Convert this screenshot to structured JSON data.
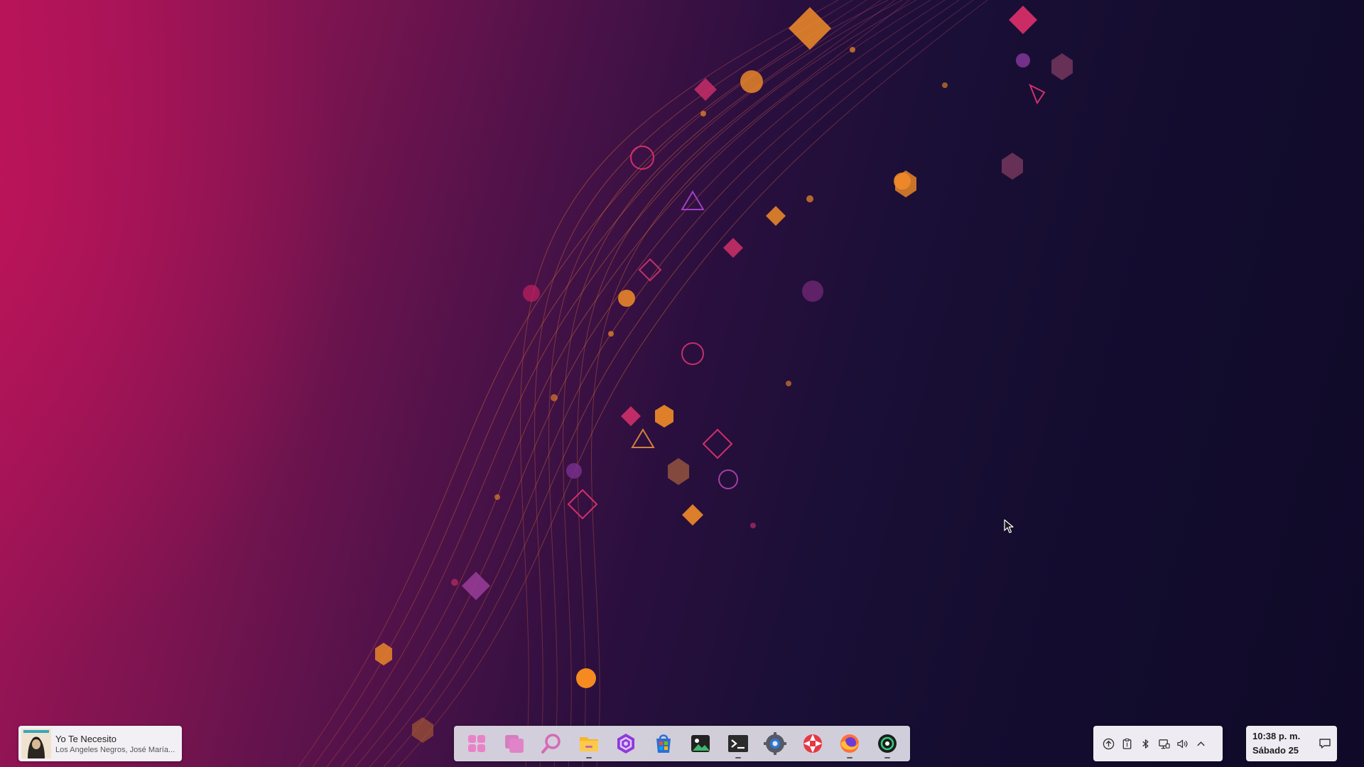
{
  "media": {
    "title": "Yo Te Necesito",
    "artist": "Los Angeles Negros, José María..."
  },
  "dock": {
    "items": [
      {
        "name": "app-launcher-icon",
        "running": false
      },
      {
        "name": "window-overview-icon",
        "running": false
      },
      {
        "name": "search-icon",
        "running": false
      },
      {
        "name": "file-manager-icon",
        "running": true
      },
      {
        "name": "hexagon-app-icon",
        "running": false
      },
      {
        "name": "app-store-icon",
        "running": false
      },
      {
        "name": "image-viewer-icon",
        "running": false
      },
      {
        "name": "terminal-icon",
        "running": true
      },
      {
        "name": "settings-icon",
        "running": false
      },
      {
        "name": "lifebuoy-app-icon",
        "running": false
      },
      {
        "name": "firefox-icon",
        "running": true
      },
      {
        "name": "music-player-icon",
        "running": true
      }
    ]
  },
  "tray": {
    "icons": [
      "updates-icon",
      "clipboard-icon",
      "bluetooth-icon",
      "network-icon",
      "volume-icon",
      "chevron-up-icon"
    ]
  },
  "clock": {
    "time": "10:38 p. m.",
    "date": "Sábado 25"
  },
  "colors": {
    "accent_pink": "#c2185b",
    "accent_orange": "#f28c28",
    "bg_dark": "#130c2e"
  }
}
